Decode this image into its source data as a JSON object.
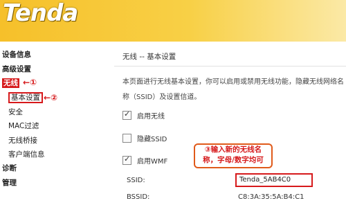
{
  "logo": "Tenda",
  "sidebar": {
    "items": [
      {
        "label": "设备信息"
      },
      {
        "label": "高级设置"
      },
      {
        "label": "无线"
      },
      {
        "label": "基本设置"
      },
      {
        "label": "安全"
      },
      {
        "label": "MAC过滤"
      },
      {
        "label": "无线桥接"
      },
      {
        "label": "客户端信息"
      },
      {
        "label": "诊断"
      },
      {
        "label": "管理"
      }
    ]
  },
  "annotations": {
    "step1": "←①",
    "step2": "←②",
    "step3_line1": "③输入新的无线名",
    "step3_line2": "称，字母/数字均可"
  },
  "main": {
    "title": "无线 -- 基本设置",
    "description": "本页面进行无线基本设置，你可以启用或禁用无线功能，隐藏无线网络名称（SSID）及设置信道。",
    "checkboxes": [
      {
        "label": "启用无线",
        "checked": true
      },
      {
        "label": "隐藏SSID",
        "checked": false
      },
      {
        "label": "启用WMF",
        "checked": true
      }
    ],
    "ssid_label": "SSID:",
    "ssid_value": "Tenda_5AB4C0",
    "bssid_label": "BSSID:",
    "bssid_value": "C8:3A:35:5A:B4:C1"
  },
  "colors": {
    "header": "#f6c02a",
    "annotation_red": "#d6191b"
  }
}
